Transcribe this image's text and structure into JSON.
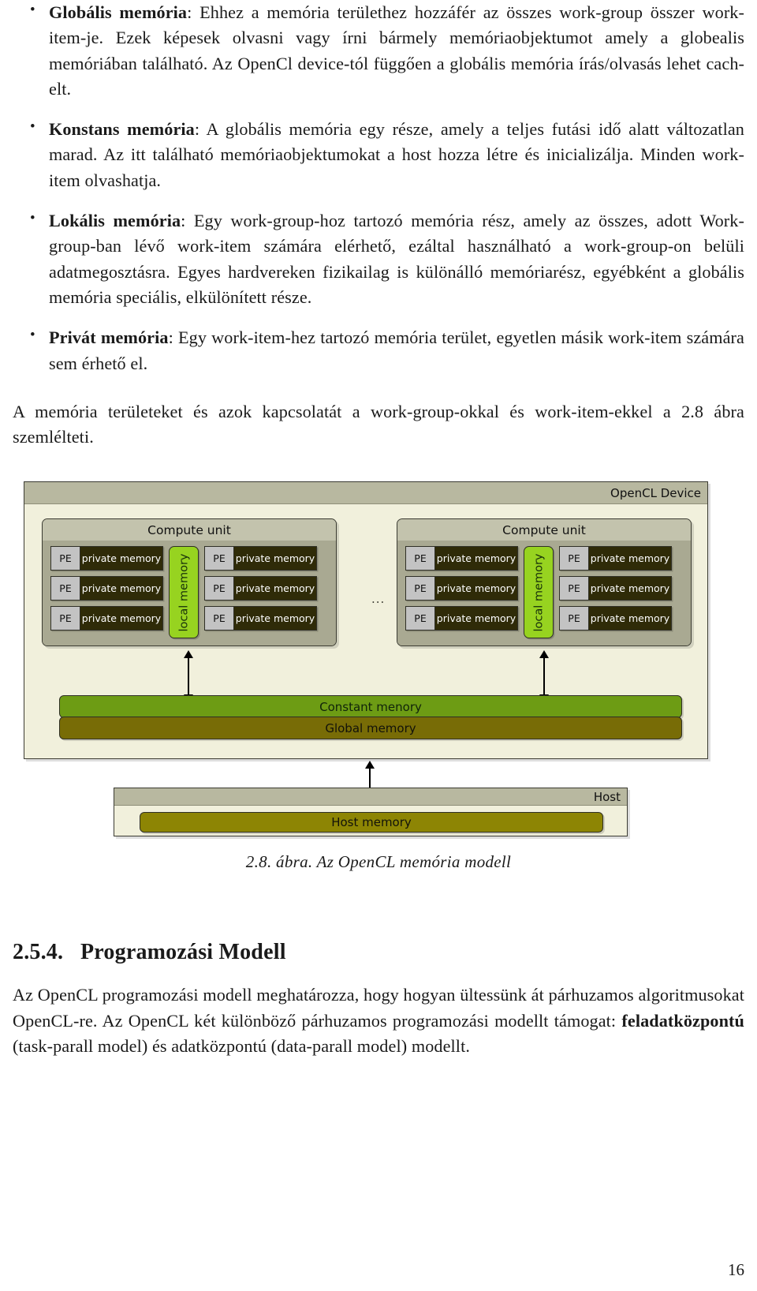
{
  "memory_types": [
    {
      "term": "Globális memória",
      "text": ": Ehhez a memória területhez hozzáfér az összes work-group összer work-item-je. Ezek képesek olvasni vagy írni bármely memóriaobjektumot amely a globealis memóriában található. Az OpenCl device-tól függően a globális memória írás/olvasás lehet cach-elt."
    },
    {
      "term": "Konstans memória",
      "text": ": A globális memória egy része, amely a teljes futási idő alatt változatlan marad. Az itt található memóriaobjektumokat a host hozza létre és inicializálja. Minden work-item olvashatja."
    },
    {
      "term": "Lokális memória",
      "text": ": Egy work-group-hoz tartozó memória rész, amely az összes, adott Work-group-ban lévő work-item számára elérhető, ezáltal használható a work-group-on belüli adatmegosztásra. Egyes hardvereken fizikailag is különálló memóriarész, egyébként a globális memória speciális, elkülönített része."
    },
    {
      "term": "Privát memória",
      "text": ": Egy work-item-hez tartozó memória terület, egyetlen másik work-item számára sem érhető el."
    }
  ],
  "intro_paragraph": "A memória területeket és azok kapcsolatát a work-group-okkal és work-item-ekkel a 2.8 ábra szemlélteti.",
  "figure": {
    "caption": "2.8. ábra. Az OpenCL memória modell",
    "device_label": "OpenCL Device",
    "compute_unit_label": "Compute unit",
    "pe_label": "PE",
    "private_memory_label": "private memory",
    "local_memory_label": "local memory",
    "ellipsis": "...",
    "constant_memory_label": "Constant menory",
    "global_memory_label": "Global memory",
    "host_label": "Host",
    "host_memory_label": "Host memory",
    "colors": {
      "device_fill": "#f1f0dc",
      "titlebar": "#b8b8a0",
      "compute_unit_fill": "#a9a992",
      "private_memory": "#2f2b08",
      "pe": "#c3c3c3",
      "local_memory": "#97d320",
      "constant_memory": "#6d9c14",
      "global_memory": "#786c06",
      "host_memory": "#8d8504"
    }
  },
  "section": {
    "number": "2.5.4.",
    "title": "Programozási Modell",
    "paragraph_before_bold": "Az OpenCL programozási modell meghatározza, hogy hogyan ültessünk át párhuzamos algoritmusokat OpenCL-re. Az OpenCL két különböző párhuzamos programozási modellt támogat: ",
    "paragraph_bold": "feladatközpontú",
    "paragraph_after_bold": " (task-parall model) és adatközpontú (data-parall model) modellt."
  },
  "page_number": "16"
}
